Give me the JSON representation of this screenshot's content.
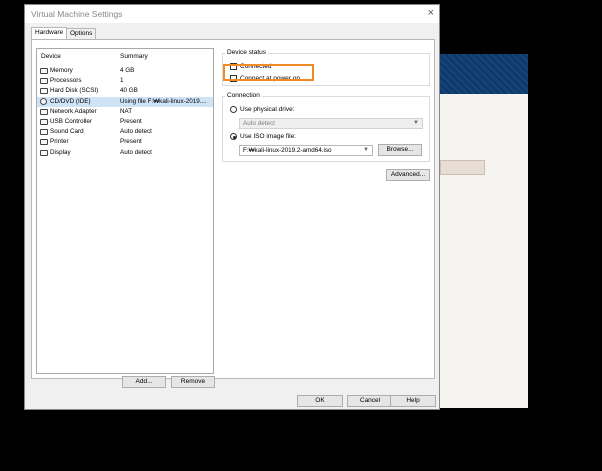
{
  "dialog": {
    "title": "Virtual Machine Settings",
    "close_glyph": "×"
  },
  "tabs": [
    {
      "label": "Hardware",
      "active": true
    },
    {
      "label": "Options",
      "active": false
    }
  ],
  "devices": {
    "col_device": "Device",
    "col_summary": "Summary",
    "rows": [
      {
        "name": "Memory",
        "summary": "4 GB",
        "icon": "memory-icon"
      },
      {
        "name": "Processors",
        "summary": "1",
        "icon": "processor-icon"
      },
      {
        "name": "Hard Disk (SCSI)",
        "summary": "40 GB",
        "icon": "hard-disk-icon"
      },
      {
        "name": "CD/DVD (IDE)",
        "summary": "Using file F:₩kali-linux-2019....",
        "icon": "cd-dvd-icon",
        "selected": true
      },
      {
        "name": "Network Adapter",
        "summary": "NAT",
        "icon": "network-adapter-icon"
      },
      {
        "name": "USB Controller",
        "summary": "Present",
        "icon": "usb-icon"
      },
      {
        "name": "Sound Card",
        "summary": "Auto detect",
        "icon": "sound-card-icon"
      },
      {
        "name": "Printer",
        "summary": "Present",
        "icon": "printer-icon"
      },
      {
        "name": "Display",
        "summary": "Auto detect",
        "icon": "display-icon"
      }
    ],
    "add_label": "Add...",
    "remove_label": "Remove"
  },
  "device_status": {
    "label": "Device status",
    "connected_label": "Connected",
    "connected_checked": false,
    "power_on_label": "Connect at power on",
    "power_on_checked": false
  },
  "connection": {
    "label": "Connection",
    "physical_label": "Use physical drive:",
    "physical_value": "Auto detect",
    "iso_label": "Use ISO image file:",
    "iso_value": "F:₩kali-linux-2019.2-amd64.iso",
    "browse_label": "Browse...",
    "selected": "iso"
  },
  "advanced_label": "Advanced...",
  "footer": {
    "ok_label": "OK",
    "cancel_label": "Cancel",
    "help_label": "Help"
  },
  "colors": {
    "highlight": "#f08a24",
    "selection": "#cfe3f7",
    "background_header": "#0d3a6e"
  }
}
